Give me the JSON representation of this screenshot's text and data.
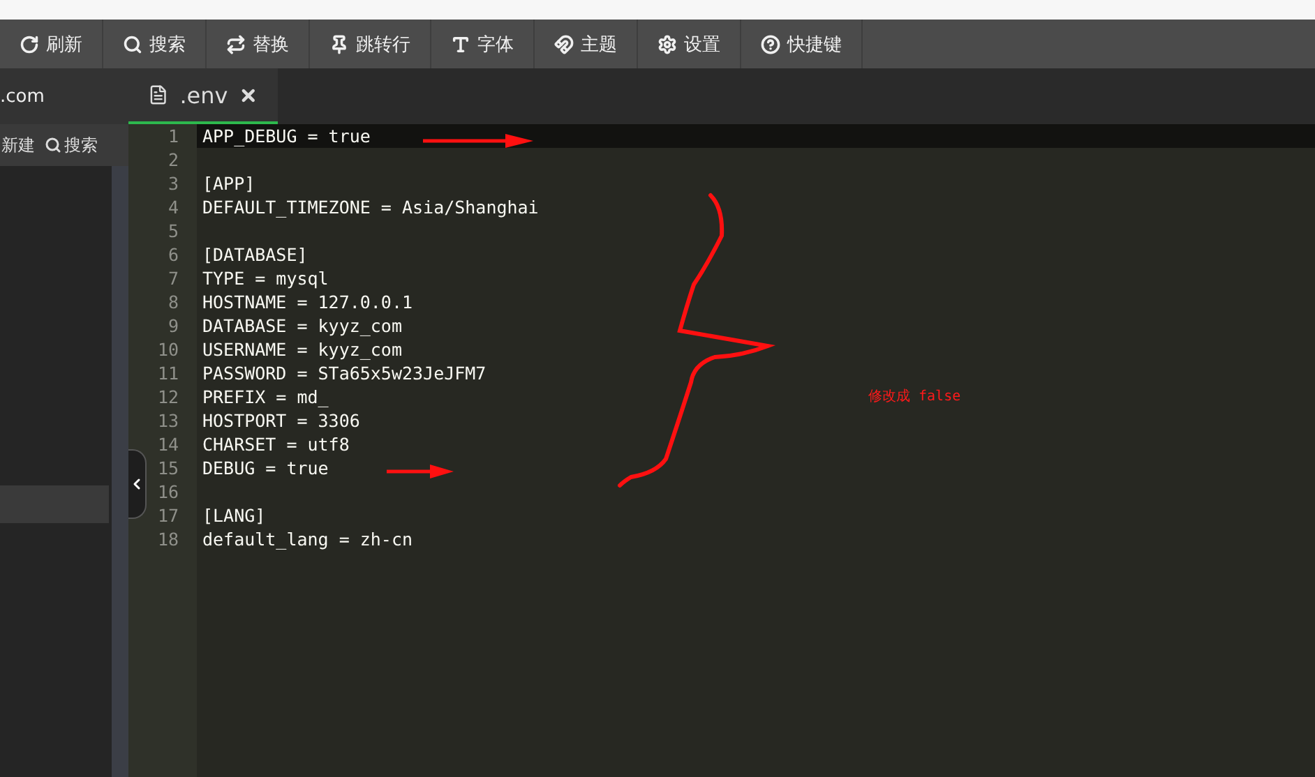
{
  "toolbar": [
    {
      "label": "刷新"
    },
    {
      "label": "搜索"
    },
    {
      "label": "替换"
    },
    {
      "label": "跳转行"
    },
    {
      "label": "字体"
    },
    {
      "label": "主题"
    },
    {
      "label": "设置"
    },
    {
      "label": "快捷键"
    }
  ],
  "sidebar": {
    "title": ".com",
    "actions": [
      {
        "label": "新建"
      },
      {
        "label": "搜索"
      }
    ],
    "rows": [
      {
        "selected": true
      }
    ]
  },
  "tabs": [
    {
      "label": ".env",
      "selected": true
    }
  ],
  "editor": {
    "lines": [
      {
        "number": "1",
        "text": "APP_DEBUG = true",
        "active": true
      },
      {
        "number": "2",
        "active": false
      },
      {
        "number": "3",
        "text": "[APP]",
        "active": false
      },
      {
        "number": "4",
        "text": "DEFAULT_TIMEZONE = Asia/Shanghai",
        "active": false
      },
      {
        "number": "5",
        "active": false
      },
      {
        "number": "6",
        "text": "[DATABASE]",
        "active": false
      },
      {
        "number": "7",
        "text": "TYPE = mysql",
        "active": false
      },
      {
        "number": "8",
        "text": "HOSTNAME = 127.0.0.1",
        "active": false
      },
      {
        "number": "9",
        "text": "DATABASE = kyyz_com",
        "active": false
      },
      {
        "number": "10",
        "text": "USERNAME = kyyz_com",
        "active": false
      },
      {
        "number": "11",
        "text": "PASSWORD = STa65x5w23JeJFM7",
        "active": false
      },
      {
        "number": "12",
        "text": "PREFIX = md_",
        "active": false
      },
      {
        "number": "13",
        "text": "HOSTPORT = 3306",
        "active": false
      },
      {
        "number": "14",
        "text": "CHARSET = utf8",
        "active": false
      },
      {
        "number": "15",
        "text": "DEBUG = true",
        "active": false
      },
      {
        "number": "16",
        "active": false
      },
      {
        "number": "17",
        "text": "[LANG]",
        "active": false
      },
      {
        "number": "18",
        "text": "default_lang = zh-cn",
        "active": false
      }
    ]
  },
  "annotation": {
    "note": "修改成 false"
  }
}
